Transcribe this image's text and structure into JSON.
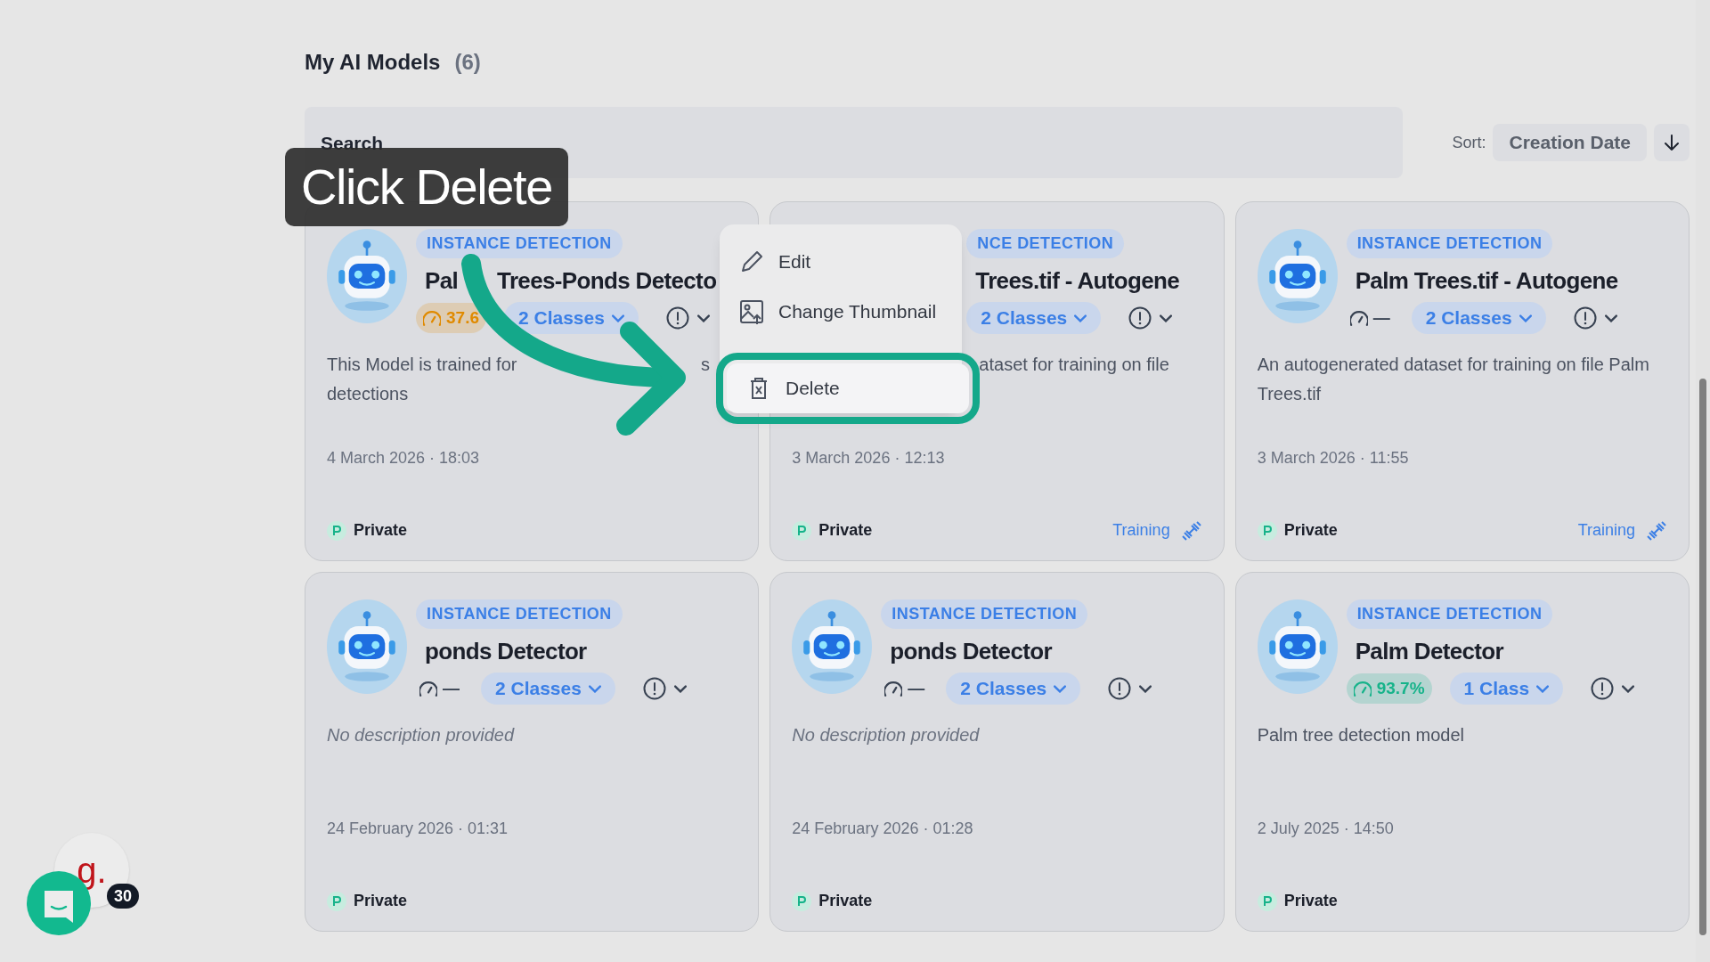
{
  "page_title": "My AI Models",
  "count": "(6)",
  "search": {
    "placeholder": "Search"
  },
  "sort": {
    "label": "Sort:",
    "value": "Creation Date"
  },
  "models": [
    {
      "covered": false,
      "badge": "INSTANCE DETECTION",
      "title": [
        "Pal",
        "Trees-Ponds Detecto"
      ],
      "score": {
        "text": "37.6",
        "color": "#e08a00"
      },
      "classes": "2 Classes",
      "description": [
        "This Model is trained for",
        "s",
        "detections"
      ],
      "empty": false,
      "date": "4 March 2026 · 18:03",
      "visibility": "Private"
    },
    {
      "covered": true,
      "badge": "NCE DETECTION",
      "title": [
        "Trees.tif - Autogene"
      ],
      "classes": "2 Classes",
      "description": [
        "ataset for training on file"
      ],
      "empty": false,
      "date": "3 March 2026 · 12:13",
      "visibility": "Private",
      "status": "Training"
    },
    {
      "covered": false,
      "badge": "INSTANCE DETECTION",
      "title": [
        "Palm Trees.tif - Autogene"
      ],
      "score": {
        "text": "—"
      },
      "classes": "2 Classes",
      "description": [
        "An autogenerated dataset for training on file Palm Trees.tif"
      ],
      "empty": false,
      "date": "3 March 2026 · 11:55",
      "visibility": "Private",
      "status": "Training"
    },
    {
      "covered": false,
      "badge": "INSTANCE DETECTION",
      "title": [
        "ponds Detector"
      ],
      "score": {
        "text": "—"
      },
      "classes": "2 Classes",
      "description": [
        "No description provided"
      ],
      "empty": true,
      "date": "24 February 2026 · 01:31",
      "visibility": "Private"
    },
    {
      "covered": false,
      "badge": "INSTANCE DETECTION",
      "title": [
        "ponds Detector"
      ],
      "score": {
        "text": "—"
      },
      "classes": "2 Classes",
      "description": [
        "No description provided"
      ],
      "empty": true,
      "date": "24 February 2026 · 01:28",
      "visibility": "Private"
    },
    {
      "covered": false,
      "badge": "INSTANCE DETECTION",
      "title": [
        "Palm Detector"
      ],
      "score": {
        "text": "93.7%",
        "color": "#16b38a"
      },
      "classes": "1 Class",
      "description": [
        "Palm tree detection model"
      ],
      "empty": false,
      "date": "2 July 2025 · 14:50",
      "visibility": "Private"
    }
  ],
  "context_menu": {
    "items": [
      {
        "kind": "edit",
        "label": "Edit",
        "highlighted": false
      },
      {
        "kind": "thumbnail",
        "label": "Change Thumbnail",
        "highlighted": false
      },
      {
        "kind": "delete",
        "label": "Delete",
        "highlighted": true
      }
    ]
  },
  "callout": {
    "text": "Click Delete"
  },
  "widgets": {
    "logo_text": "g.",
    "badge": "30"
  }
}
